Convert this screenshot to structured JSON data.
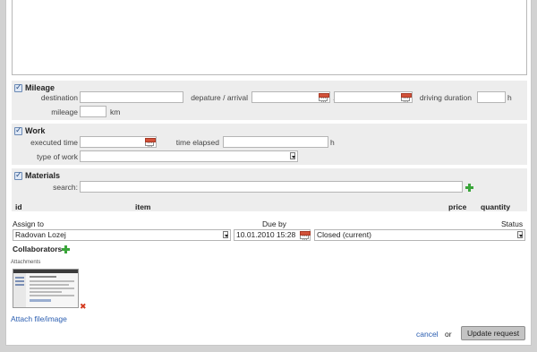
{
  "mileage": {
    "title": "Mileage",
    "destination_label": "destination",
    "departure_label": "depature / arrival",
    "separator": "/",
    "driving_label": "driving duration",
    "driving_unit": "h",
    "mileage_label": "mileage",
    "mileage_unit": "km"
  },
  "work": {
    "title": "Work",
    "executed_label": "executed time",
    "elapsed_label": "time elapsed",
    "elapsed_unit": "h",
    "type_label": "type of work"
  },
  "materials": {
    "title": "Materials",
    "search_label": "search:",
    "columns": [
      "id",
      "item",
      "price",
      "quantity"
    ]
  },
  "assign": {
    "assign_label": "Assign to",
    "assign_value": "Radovan Lozej",
    "due_label": "Due by",
    "due_value": "10.01.2010 15:28",
    "status_label": "Status",
    "status_value": "Closed (current)"
  },
  "collaborators_label": "Collaborators",
  "attachments": {
    "label": "Attachments",
    "attach_link": "Attach file/image"
  },
  "footer": {
    "cancel": "cancel",
    "or": "or",
    "update": "Update request"
  },
  "icons": [
    "checkbox-icon",
    "calendar-icon",
    "dropdown-arrow-icon",
    "add-icon",
    "delete-icon"
  ],
  "colors": {
    "link": "#2a5db0",
    "add": "#3aa53a",
    "delete": "#d43a1f",
    "section_bg": "#ededed"
  }
}
